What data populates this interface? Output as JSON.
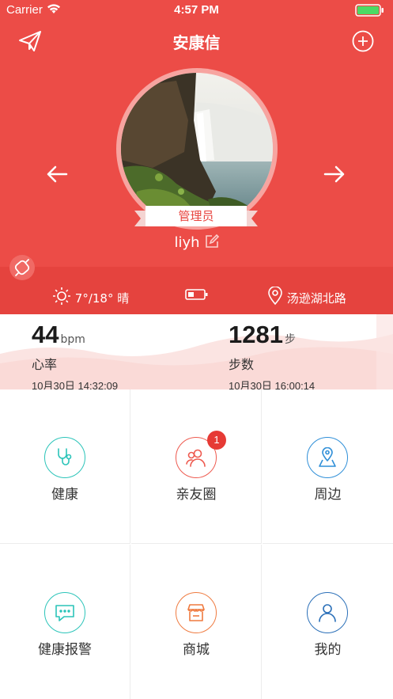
{
  "status_bar": {
    "carrier": "Carrier",
    "time": "4:57 PM"
  },
  "nav": {
    "title": "安康信",
    "left_icon": "paper-plane-icon",
    "right_icon": "plus-circle-icon"
  },
  "profile": {
    "role_badge": "管理员",
    "username": "liyh"
  },
  "info": {
    "weather": "7°/18° 晴",
    "location": "汤逊湖北路"
  },
  "stats": {
    "heart": {
      "value": "44",
      "unit": "bpm",
      "label": "心率",
      "timestamp": "10月30日 14:32:09"
    },
    "steps": {
      "value": "1281",
      "unit": "步",
      "label": "步数",
      "timestamp": "10月30日 16:00:14"
    }
  },
  "menu": {
    "items": [
      {
        "label": "健康",
        "icon": "stethoscope-icon",
        "color": "#2bc4b9"
      },
      {
        "label": "亲友圈",
        "icon": "friends-icon",
        "color": "#ee5a4f",
        "badge": "1"
      },
      {
        "label": "周边",
        "icon": "map-pin-icon",
        "color": "#2f8fd8"
      },
      {
        "label": "健康报警",
        "icon": "chat-alert-icon",
        "color": "#2bc4b9"
      },
      {
        "label": "商城",
        "icon": "store-icon",
        "color": "#ef7a3f"
      },
      {
        "label": "我的",
        "icon": "user-icon",
        "color": "#2a6fb8"
      }
    ]
  },
  "colors": {
    "brand_red": "#ec4c47",
    "white": "#ffffff"
  }
}
